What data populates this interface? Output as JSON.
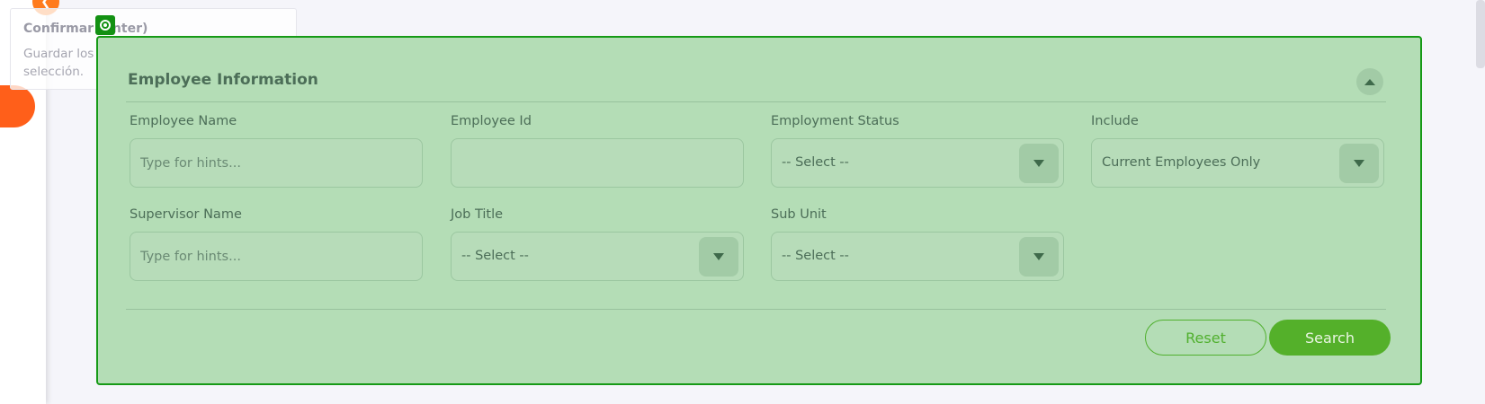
{
  "tooltip": {
    "title": "Confirmar (Enter)",
    "body": "Guardar los cambios y cerrar el asistente de selección."
  },
  "section": {
    "title": "Employee Information"
  },
  "fields": {
    "employee_name": {
      "label": "Employee Name",
      "placeholder": "Type for hints...",
      "value": ""
    },
    "employee_id": {
      "label": "Employee Id",
      "value": ""
    },
    "employment_status": {
      "label": "Employment Status",
      "value": "-- Select --"
    },
    "include": {
      "label": "Include",
      "value": "Current Employees Only"
    },
    "supervisor_name": {
      "label": "Supervisor Name",
      "placeholder": "Type for hints...",
      "value": ""
    },
    "job_title": {
      "label": "Job Title",
      "value": "-- Select --"
    },
    "sub_unit": {
      "label": "Sub Unit",
      "value": "-- Select --"
    }
  },
  "actions": {
    "reset_label": "Reset",
    "search_label": "Search"
  },
  "icons": {
    "collapse": "chevron-left-icon",
    "marker": "target-icon",
    "toggle": "caret-up-icon",
    "dropdown": "caret-down-icon"
  },
  "colors": {
    "accent_orange": "#ff5f1a",
    "highlight_green": "#169a16",
    "button_green": "#54b02a",
    "overlay_fill": "#b4ddb6"
  }
}
